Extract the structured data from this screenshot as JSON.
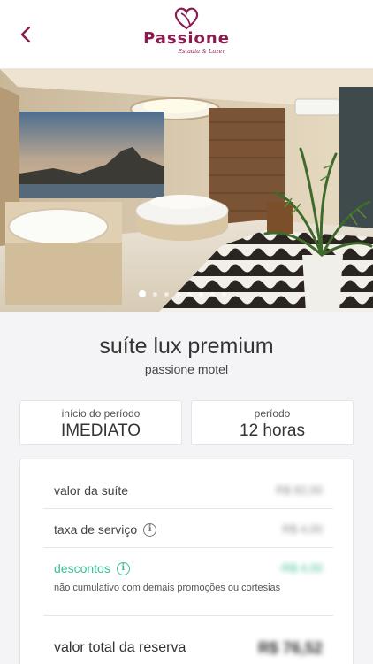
{
  "header": {
    "back_icon": "chevron-left-icon",
    "logo_name": "Passione",
    "logo_tagline": "Estadia & Lazer",
    "brand_color": "#8a1a4f"
  },
  "carousel": {
    "total_slides": 8,
    "active_index": 0
  },
  "suite": {
    "name": "suíte lux premium",
    "motel": "passione motel"
  },
  "period": {
    "start_label": "início do período",
    "start_value": "IMEDIATO",
    "duration_label": "período",
    "duration_value": "12 horas"
  },
  "summary": {
    "suite_price_label": "valor da suíte",
    "suite_price_value": "R$ 82,00",
    "service_fee_label": "taxa de serviço",
    "service_fee_value": "R$ 4,00",
    "discount_label": "descontos",
    "discount_value": "-R$ 4,00",
    "discount_note": "não cumulativo com demais promoções ou cortesias",
    "total_label": "valor total da reserva",
    "total_value": "R$ 76,52",
    "discount_color": "#3dbf96"
  }
}
